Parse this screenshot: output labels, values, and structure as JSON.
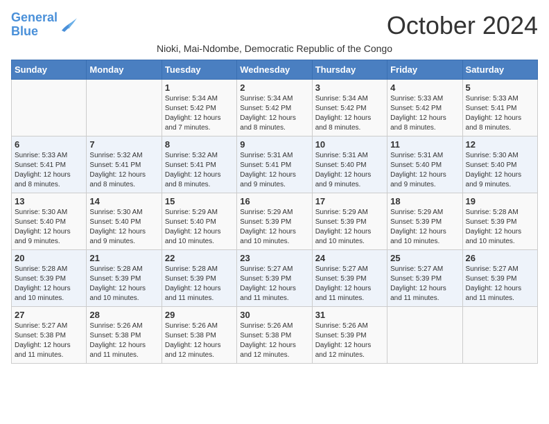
{
  "logo": {
    "text_general": "General",
    "text_blue": "Blue"
  },
  "title": "October 2024",
  "subtitle": "Nioki, Mai-Ndombe, Democratic Republic of the Congo",
  "days_header": [
    "Sunday",
    "Monday",
    "Tuesday",
    "Wednesday",
    "Thursday",
    "Friday",
    "Saturday"
  ],
  "weeks": [
    [
      {
        "day": "",
        "info": ""
      },
      {
        "day": "",
        "info": ""
      },
      {
        "day": "1",
        "info": "Sunrise: 5:34 AM\nSunset: 5:42 PM\nDaylight: 12 hours and 7 minutes."
      },
      {
        "day": "2",
        "info": "Sunrise: 5:34 AM\nSunset: 5:42 PM\nDaylight: 12 hours and 8 minutes."
      },
      {
        "day": "3",
        "info": "Sunrise: 5:34 AM\nSunset: 5:42 PM\nDaylight: 12 hours and 8 minutes."
      },
      {
        "day": "4",
        "info": "Sunrise: 5:33 AM\nSunset: 5:42 PM\nDaylight: 12 hours and 8 minutes."
      },
      {
        "day": "5",
        "info": "Sunrise: 5:33 AM\nSunset: 5:41 PM\nDaylight: 12 hours and 8 minutes."
      }
    ],
    [
      {
        "day": "6",
        "info": "Sunrise: 5:33 AM\nSunset: 5:41 PM\nDaylight: 12 hours and 8 minutes."
      },
      {
        "day": "7",
        "info": "Sunrise: 5:32 AM\nSunset: 5:41 PM\nDaylight: 12 hours and 8 minutes."
      },
      {
        "day": "8",
        "info": "Sunrise: 5:32 AM\nSunset: 5:41 PM\nDaylight: 12 hours and 8 minutes."
      },
      {
        "day": "9",
        "info": "Sunrise: 5:31 AM\nSunset: 5:41 PM\nDaylight: 12 hours and 9 minutes."
      },
      {
        "day": "10",
        "info": "Sunrise: 5:31 AM\nSunset: 5:40 PM\nDaylight: 12 hours and 9 minutes."
      },
      {
        "day": "11",
        "info": "Sunrise: 5:31 AM\nSunset: 5:40 PM\nDaylight: 12 hours and 9 minutes."
      },
      {
        "day": "12",
        "info": "Sunrise: 5:30 AM\nSunset: 5:40 PM\nDaylight: 12 hours and 9 minutes."
      }
    ],
    [
      {
        "day": "13",
        "info": "Sunrise: 5:30 AM\nSunset: 5:40 PM\nDaylight: 12 hours and 9 minutes."
      },
      {
        "day": "14",
        "info": "Sunrise: 5:30 AM\nSunset: 5:40 PM\nDaylight: 12 hours and 9 minutes."
      },
      {
        "day": "15",
        "info": "Sunrise: 5:29 AM\nSunset: 5:40 PM\nDaylight: 12 hours and 10 minutes."
      },
      {
        "day": "16",
        "info": "Sunrise: 5:29 AM\nSunset: 5:39 PM\nDaylight: 12 hours and 10 minutes."
      },
      {
        "day": "17",
        "info": "Sunrise: 5:29 AM\nSunset: 5:39 PM\nDaylight: 12 hours and 10 minutes."
      },
      {
        "day": "18",
        "info": "Sunrise: 5:29 AM\nSunset: 5:39 PM\nDaylight: 12 hours and 10 minutes."
      },
      {
        "day": "19",
        "info": "Sunrise: 5:28 AM\nSunset: 5:39 PM\nDaylight: 12 hours and 10 minutes."
      }
    ],
    [
      {
        "day": "20",
        "info": "Sunrise: 5:28 AM\nSunset: 5:39 PM\nDaylight: 12 hours and 10 minutes."
      },
      {
        "day": "21",
        "info": "Sunrise: 5:28 AM\nSunset: 5:39 PM\nDaylight: 12 hours and 10 minutes."
      },
      {
        "day": "22",
        "info": "Sunrise: 5:28 AM\nSunset: 5:39 PM\nDaylight: 12 hours and 11 minutes."
      },
      {
        "day": "23",
        "info": "Sunrise: 5:27 AM\nSunset: 5:39 PM\nDaylight: 12 hours and 11 minutes."
      },
      {
        "day": "24",
        "info": "Sunrise: 5:27 AM\nSunset: 5:39 PM\nDaylight: 12 hours and 11 minutes."
      },
      {
        "day": "25",
        "info": "Sunrise: 5:27 AM\nSunset: 5:39 PM\nDaylight: 12 hours and 11 minutes."
      },
      {
        "day": "26",
        "info": "Sunrise: 5:27 AM\nSunset: 5:39 PM\nDaylight: 12 hours and 11 minutes."
      }
    ],
    [
      {
        "day": "27",
        "info": "Sunrise: 5:27 AM\nSunset: 5:38 PM\nDaylight: 12 hours and 11 minutes."
      },
      {
        "day": "28",
        "info": "Sunrise: 5:26 AM\nSunset: 5:38 PM\nDaylight: 12 hours and 11 minutes."
      },
      {
        "day": "29",
        "info": "Sunrise: 5:26 AM\nSunset: 5:38 PM\nDaylight: 12 hours and 12 minutes."
      },
      {
        "day": "30",
        "info": "Sunrise: 5:26 AM\nSunset: 5:38 PM\nDaylight: 12 hours and 12 minutes."
      },
      {
        "day": "31",
        "info": "Sunrise: 5:26 AM\nSunset: 5:39 PM\nDaylight: 12 hours and 12 minutes."
      },
      {
        "day": "",
        "info": ""
      },
      {
        "day": "",
        "info": ""
      }
    ]
  ]
}
